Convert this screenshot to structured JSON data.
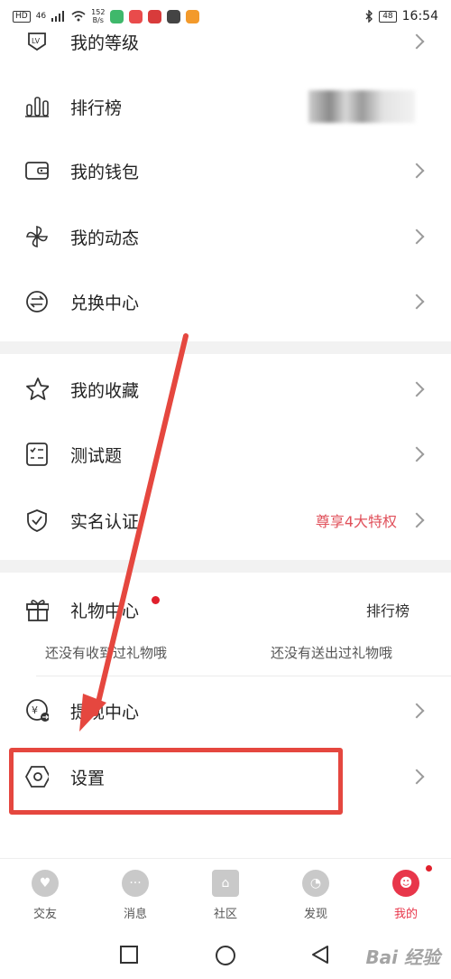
{
  "status_bar": {
    "hd": "HD",
    "signal": "46",
    "speed_value": "152",
    "speed_unit": "B/s",
    "battery": "48",
    "time": "16:54"
  },
  "menu": {
    "level": "我的等级",
    "ranking": "排行榜",
    "wallet": "我的钱包",
    "moments": "我的动态",
    "exchange": "兑换中心",
    "favorites": "我的收藏",
    "quiz": "测试题",
    "realname": "实名认证",
    "realname_extra": "尊享4大特权",
    "gift_center": "礼物中心",
    "gift_ranking": "排行榜",
    "gift_received_empty": "还没有收到过礼物哦",
    "gift_sent_empty": "还没有送出过礼物哦",
    "withdraw": "提现中心",
    "settings": "设置"
  },
  "bottom_nav": {
    "items": [
      {
        "label": "交友"
      },
      {
        "label": "消息"
      },
      {
        "label": "社区"
      },
      {
        "label": "发现"
      },
      {
        "label": "我的"
      }
    ]
  },
  "watermark": "Bai 经验",
  "colors": {
    "accent": "#e8364a",
    "highlight": "#e5473f",
    "privilege_text": "#e0505a"
  }
}
